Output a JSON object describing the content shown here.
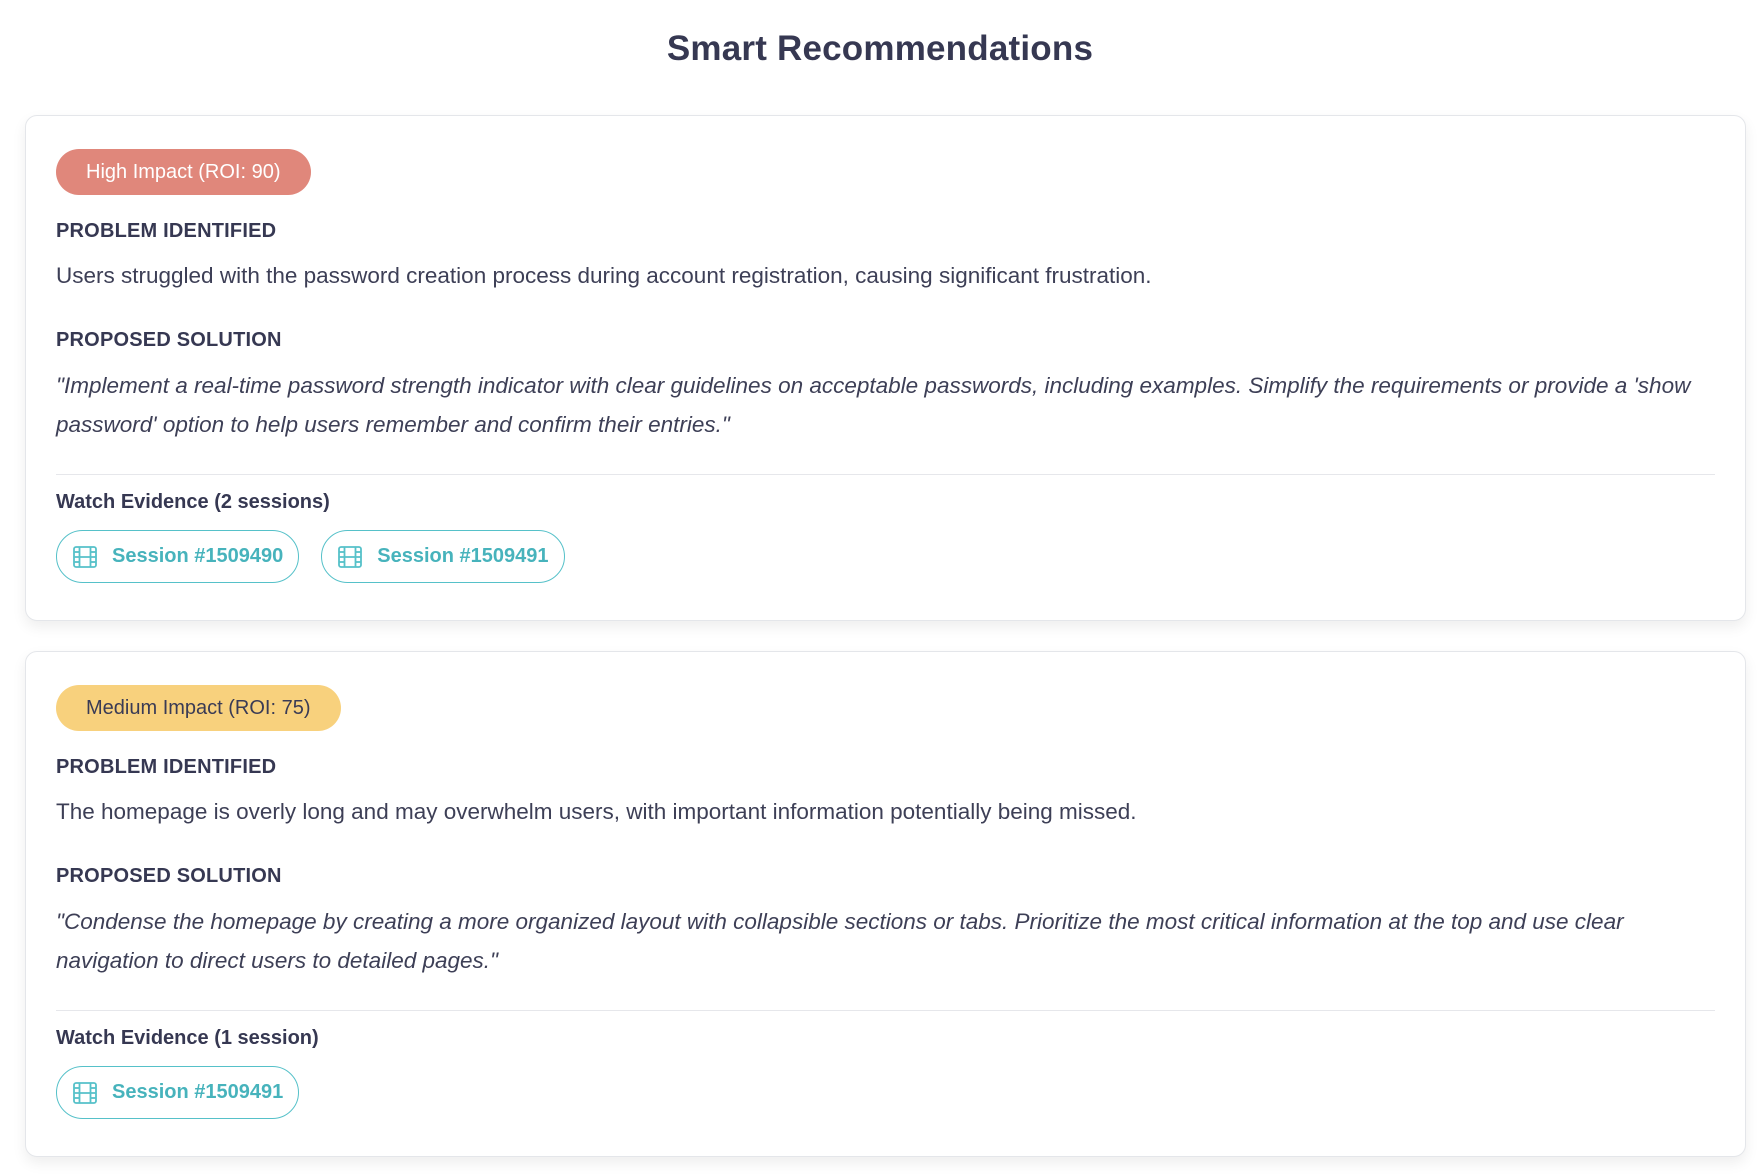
{
  "title": "Smart Recommendations",
  "labels": {
    "problem": "PROBLEM IDENTIFIED",
    "solution": "PROPOSED SOLUTION"
  },
  "recommendations": [
    {
      "badge": "High Impact (ROI: 90)",
      "impact": "high",
      "problem": "Users struggled with the password creation process during account registration, causing significant frustration.",
      "solution": "\"Implement a real-time password strength indicator with clear guidelines on acceptable passwords, including examples. Simplify the requirements or provide a 'show password' option to help users remember and confirm their entries.\"",
      "evidence_label": "Watch Evidence (2 sessions)",
      "sessions": [
        "Session #1509490",
        "Session #1509491"
      ]
    },
    {
      "badge": "Medium Impact (ROI: 75)",
      "impact": "medium",
      "problem": "The homepage is overly long and may overwhelm users, with important information potentially being missed.",
      "solution": "\"Condense the homepage by creating a more organized layout with collapsible sections or tabs. Prioritize the most critical information at the top and use clear navigation to direct users to detailed pages.\"",
      "evidence_label": "Watch Evidence (1 session)",
      "sessions": [
        "Session #1509491"
      ]
    }
  ],
  "colors": {
    "high_badge": "#e0877b",
    "medium_badge": "#f8d17d",
    "accent": "#56c1c9",
    "text": "#3a3b55"
  },
  "icons": {
    "session": "film-icon"
  }
}
